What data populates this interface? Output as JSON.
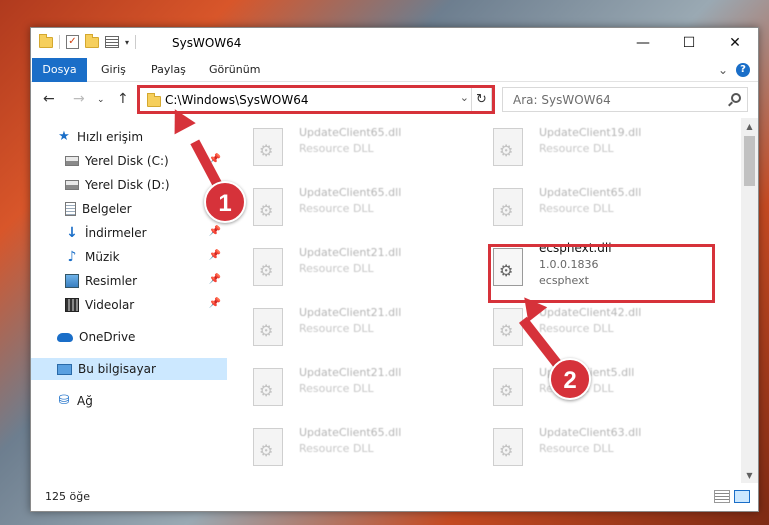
{
  "window": {
    "title": "SysWOW64",
    "quick_access_dropdown": "▾",
    "buttons": {
      "minimize": "—",
      "maximize": "☐",
      "close": "✕"
    }
  },
  "ribbon": {
    "tabs": [
      "Dosya",
      "Giriş",
      "Paylaş",
      "Görünüm"
    ],
    "collapse_chevron": "⌄",
    "help": "?"
  },
  "nav_buttons": {
    "back": "←",
    "forward": "→",
    "dropdown": "⌄",
    "up": "↑"
  },
  "address": {
    "path": "C:\\Windows\\SysWOW64",
    "dropdown": "⌄",
    "refresh": "↻"
  },
  "search": {
    "placeholder": "Ara: SysWOW64"
  },
  "sidebar": {
    "items": [
      {
        "label": "Hızlı erişim",
        "icon": "star-icon",
        "pinned": false
      },
      {
        "label": "Yerel Disk (C:)",
        "icon": "disk-icon",
        "pinned": true
      },
      {
        "label": "Yerel Disk (D:)",
        "icon": "disk-icon",
        "pinned": false
      },
      {
        "label": "Belgeler",
        "icon": "documents-icon",
        "pinned": true
      },
      {
        "label": "İndirmeler",
        "icon": "downloads-icon",
        "pinned": true
      },
      {
        "label": "Müzik",
        "icon": "music-icon",
        "pinned": true
      },
      {
        "label": "Resimler",
        "icon": "pictures-icon",
        "pinned": true
      },
      {
        "label": "Videolar",
        "icon": "videos-icon",
        "pinned": true
      },
      {
        "label": "OneDrive",
        "icon": "cloud-icon",
        "pinned": false
      },
      {
        "label": "Bu bilgisayar",
        "icon": "computer-icon",
        "pinned": false,
        "selected": true
      },
      {
        "label": "Ağ",
        "icon": "network-icon",
        "pinned": false
      }
    ],
    "pin_glyph": "📌"
  },
  "files": [
    {
      "name": "UpdateClient65.dll",
      "type": "Resource DLL"
    },
    {
      "name": "UpdateClient19.dll",
      "type": "Resource DLL"
    },
    {
      "name": "UpdateClient65.dll",
      "type": "Resource DLL"
    },
    {
      "name": "UpdateClient65.dll",
      "type": "Resource DLL"
    },
    {
      "name": "UpdateClient21.dll",
      "type": "Resource DLL"
    },
    {
      "name": "ecsphext.dll",
      "version": "1.0.0.1836",
      "type": "ecsphext"
    },
    {
      "name": "UpdateClient21.dll",
      "type": "Resource DLL"
    },
    {
      "name": "UpdateClient42.dll",
      "type": "Resource DLL"
    },
    {
      "name": "UpdateClient21.dll",
      "type": "Resource DLL"
    },
    {
      "name": "UpdateClient5.dll",
      "type": "Resource DLL"
    },
    {
      "name": "UpdateClient65.dll",
      "type": "Resource DLL"
    },
    {
      "name": "UpdateClient63.dll",
      "type": "Resource DLL"
    }
  ],
  "status": {
    "count_text": "125 öğe"
  },
  "callouts": {
    "step1": "1",
    "step2": "2"
  },
  "colors": {
    "accent": "#1a6ec8",
    "callout": "#d6323a",
    "selection": "#cce8ff"
  }
}
